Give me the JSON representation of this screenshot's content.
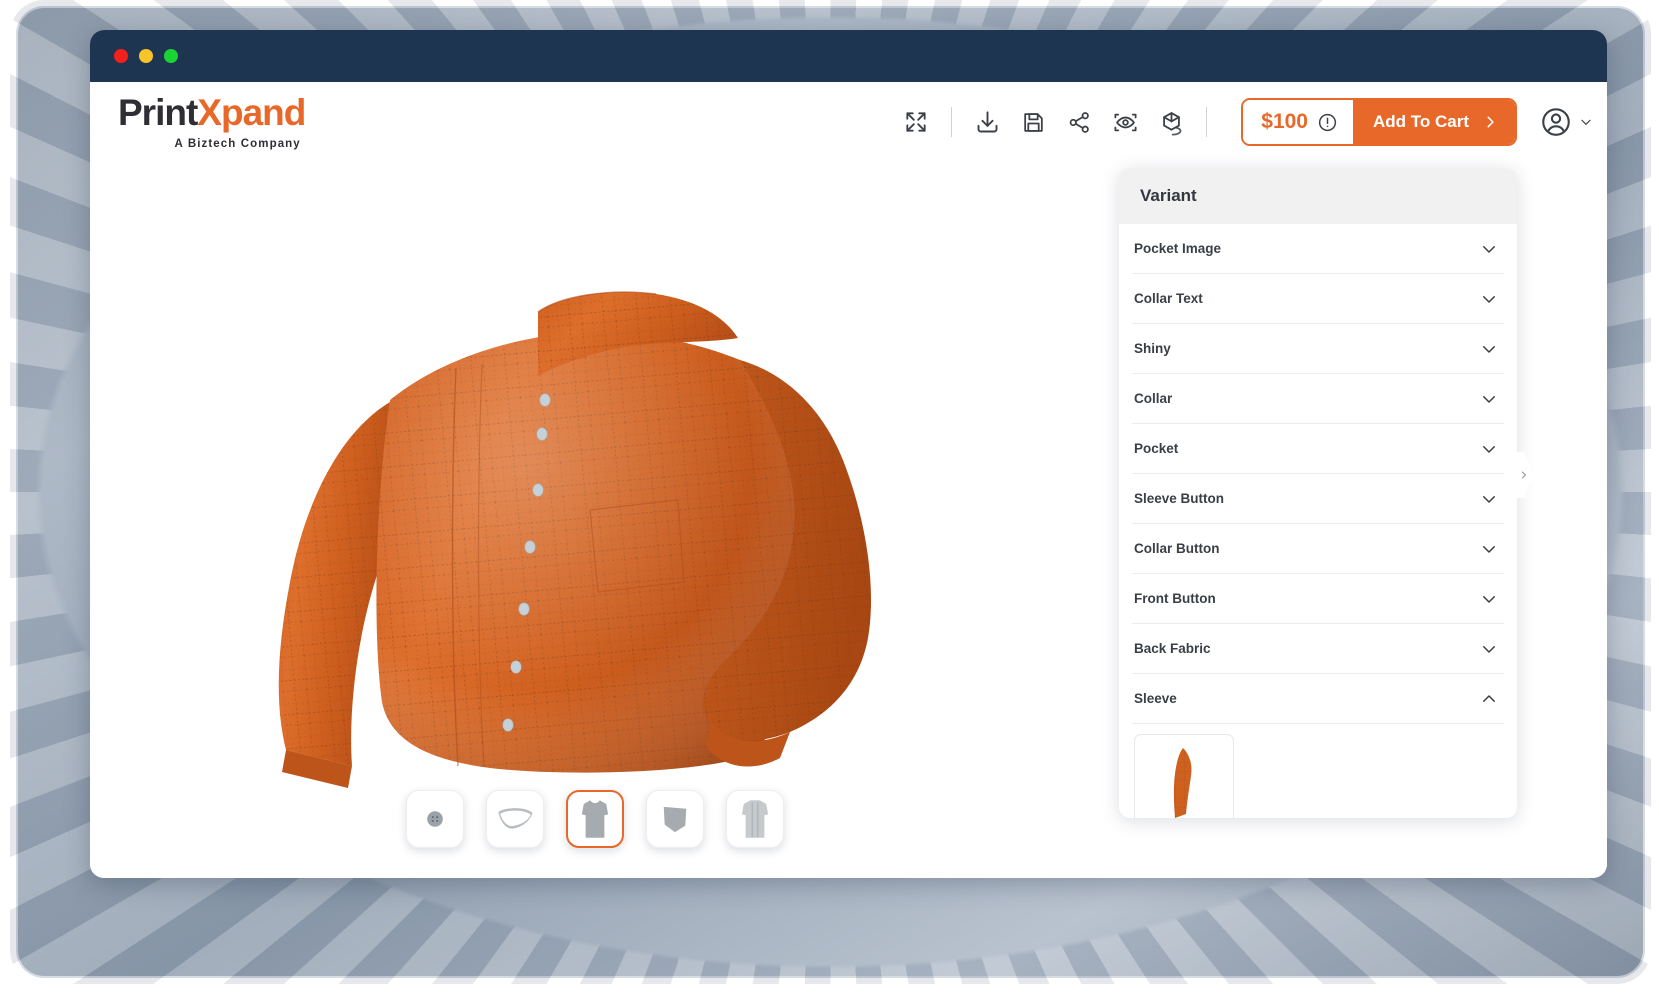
{
  "window": {
    "traffic_lights": [
      "close",
      "minimize",
      "maximize"
    ],
    "titlebar_color": "#1e3552"
  },
  "header": {
    "brand_name_part1": "Print",
    "brand_name_part2": "X",
    "brand_name_part3": "pand",
    "tagline": "A Biztech Company",
    "brand_accent_color": "#e8682a",
    "tools": [
      {
        "name": "fullscreen-icon",
        "label": "Fullscreen"
      },
      {
        "name": "download-icon",
        "label": "Download"
      },
      {
        "name": "save-icon",
        "label": "Save"
      },
      {
        "name": "share-icon",
        "label": "Share"
      },
      {
        "name": "preview-eye-icon",
        "label": "Preview"
      },
      {
        "name": "ar-3d-icon",
        "label": "3D / AR View"
      }
    ],
    "price": "$100",
    "price_info_icon": "info-icon",
    "add_to_cart_label": "Add To Cart",
    "account_icon": "user-avatar-icon",
    "account_chevron": "chevron-down-icon"
  },
  "stage": {
    "product_name": "Orange Plaid Shirt",
    "product_colors": {
      "fabric": "#d9652a",
      "fabric_shadow": "#b4501d",
      "plaid_line": "#6b3416",
      "button": "#c9d3d8"
    },
    "thumbnails": [
      {
        "name": "thumb-button",
        "label": "Button",
        "selected": false
      },
      {
        "name": "thumb-collar",
        "label": "Collar",
        "selected": false
      },
      {
        "name": "thumb-front-body",
        "label": "Front Body",
        "selected": true
      },
      {
        "name": "thumb-pocket",
        "label": "Pocket",
        "selected": false
      },
      {
        "name": "thumb-back-body",
        "label": "Back Body",
        "selected": false
      }
    ]
  },
  "variant_panel": {
    "title": "Variant",
    "collapse_handle_icon": "chevron-right-icon",
    "items": [
      {
        "label": "Pocket Image",
        "expanded": false,
        "chevron": "chevron-down-icon"
      },
      {
        "label": "Collar Text",
        "expanded": false,
        "chevron": "chevron-down-icon"
      },
      {
        "label": "Shiny",
        "expanded": false,
        "chevron": "chevron-down-icon"
      },
      {
        "label": "Collar",
        "expanded": false,
        "chevron": "chevron-down-icon"
      },
      {
        "label": "Pocket",
        "expanded": false,
        "chevron": "chevron-down-icon"
      },
      {
        "label": "Sleeve Button",
        "expanded": false,
        "chevron": "chevron-down-icon"
      },
      {
        "label": "Collar Button",
        "expanded": false,
        "chevron": "chevron-down-icon"
      },
      {
        "label": "Front Button",
        "expanded": false,
        "chevron": "chevron-down-icon"
      },
      {
        "label": "Back Fabric",
        "expanded": false,
        "chevron": "chevron-down-icon"
      },
      {
        "label": "Sleeve",
        "expanded": true,
        "chevron": "chevron-up-icon"
      }
    ],
    "sleeve_swatch": {
      "name": "sleeve-swatch-orange",
      "color": "#d9652a"
    }
  }
}
